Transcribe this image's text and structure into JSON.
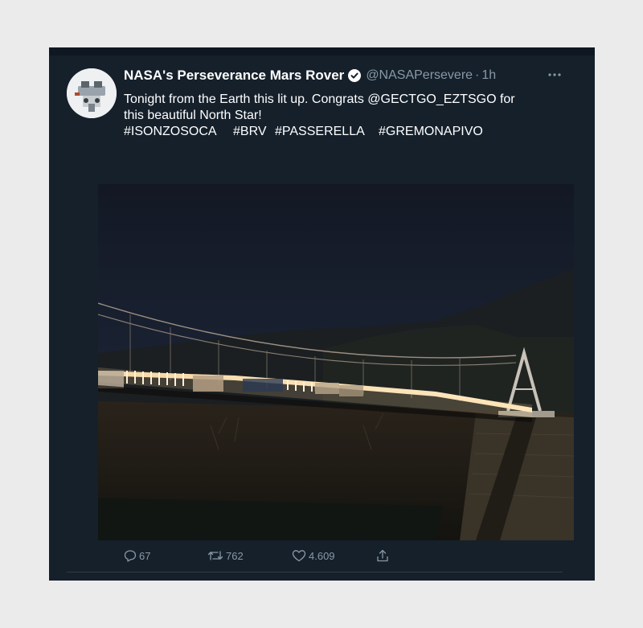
{
  "tweet": {
    "author_name": "NASA's Perseverance Mars Rover",
    "handle": "@NASAPersevere",
    "separator": "·",
    "time": "1h",
    "text_line1": "Tonight from the Earth this lit up. Congrats @GECTGO_EZTSGO for",
    "text_line2": "this beautiful North Star!",
    "hashtags": [
      "#ISONZOSOCA",
      "#BRV",
      "#PASSERELLA",
      "#GREMONAPIVO"
    ],
    "media_description_icon": "night-bridge-photo"
  },
  "actions": {
    "reply_count": "67",
    "retweet_count": "762",
    "like_count": "4.609"
  },
  "colors": {
    "background": "#15202b",
    "text_primary": "#ffffff",
    "text_secondary": "#8899a6",
    "page_background": "#ebebeb"
  },
  "icons": {
    "verified": "verified-badge-icon",
    "more": "more-dots-icon",
    "reply": "reply-icon",
    "retweet": "retweet-icon",
    "like": "heart-icon",
    "share": "share-icon"
  }
}
